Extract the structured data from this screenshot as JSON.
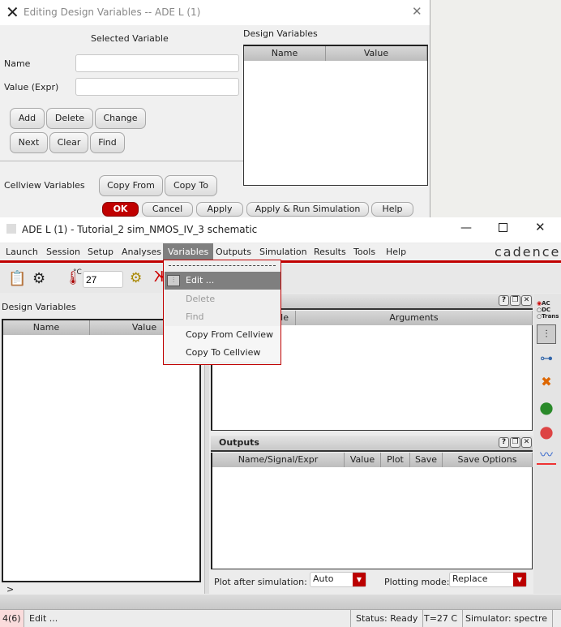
{
  "dialog": {
    "title": "Editing Design Variables -- ADE L (1)",
    "selected_variable": "Selected Variable",
    "name_label": "Name",
    "name_value": "",
    "value_label": "Value (Expr)",
    "value_value": "",
    "buttons": {
      "add": "Add",
      "delete": "Delete",
      "change": "Change",
      "next": "Next",
      "clear": "Clear",
      "find": "Find"
    },
    "cellview_label": "Cellview Variables",
    "copy_from": "Copy From",
    "copy_to": "Copy To",
    "design_vars_label": "Design Variables",
    "col_name": "Name",
    "col_value": "Value",
    "footer": {
      "ok": "OK",
      "cancel": "Cancel",
      "apply": "Apply",
      "apply_run": "Apply & Run Simulation",
      "help": "Help"
    }
  },
  "main": {
    "title": "ADE L (1) - Tutorial_2 sim_NMOS_IV_3 schematic",
    "brand": "cadence",
    "menu": [
      "Launch",
      "Session",
      "Setup",
      "Analyses",
      "Variables",
      "Outputs",
      "Simulation",
      "Results",
      "Tools",
      "Help"
    ],
    "temperature": "27",
    "temp_unit": "°C",
    "dropdown": {
      "items": [
        {
          "label": "Edit ...",
          "state": "highlighted"
        },
        {
          "label": "Delete",
          "state": "disabled"
        },
        {
          "label": "Find",
          "state": "disabled"
        },
        {
          "label": "Copy From Cellview",
          "state": "enabled"
        },
        {
          "label": "Copy To Cellview",
          "state": "enabled"
        }
      ]
    },
    "design_vars": {
      "label": "Design Variables",
      "col_name": "Name",
      "col_value": "Value"
    },
    "analyses": {
      "col_enable_partial": "ble",
      "col_arguments": "Arguments"
    },
    "outputs": {
      "title": "Outputs",
      "columns": [
        "Name/Signal/Expr",
        "Value",
        "Plot",
        "Save",
        "Save Options"
      ]
    },
    "plot_after_label": "Plot after simulation:",
    "plot_after_value": "Auto",
    "plot_mode_label": "Plotting mode:",
    "plot_mode_value": "Replace",
    "analysis_radio": [
      "AC",
      "DC",
      "Trans"
    ],
    "prompt": ">",
    "status": {
      "count": "4(6)",
      "message": "Edit ...",
      "status": "Status: Ready",
      "temp": "T=27 C",
      "simulator": "Simulator: spectre"
    }
  },
  "colors": {
    "accent_red": "#c00000",
    "menu_highlight": "#7f7f7f"
  }
}
